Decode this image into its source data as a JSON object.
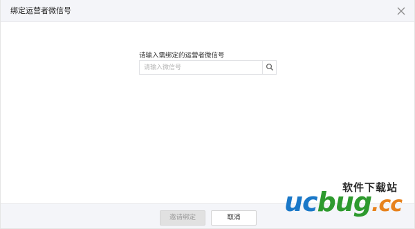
{
  "dialog": {
    "title": "绑定运营者微信号",
    "close_icon": "close-icon"
  },
  "form": {
    "label": "请输入需绑定的运营者微信号",
    "search_placeholder": "请输入微信号",
    "search_value": "",
    "search_icon": "search-icon"
  },
  "footer": {
    "invite_label": "邀请绑定",
    "cancel_label": "取消"
  },
  "watermark": {
    "site_name": "软件下载站",
    "logo_uc": "uc",
    "logo_bug": "bug",
    "logo_cc": ".cc"
  },
  "colors": {
    "header_bg": "#f4f5f9",
    "footer_bg": "#f4f5f9",
    "disabled_button_bg": "#e1e1e1",
    "watermark_blue": "#1a78c8",
    "watermark_green": "#2e9a2e",
    "watermark_orange": "#e7821d"
  }
}
